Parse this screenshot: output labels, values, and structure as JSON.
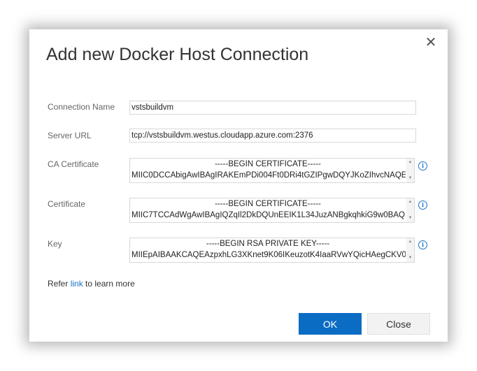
{
  "dialog": {
    "title": "Add new Docker Host Connection",
    "close_glyph": "✕"
  },
  "fields": {
    "connection_name": {
      "label": "Connection Name",
      "value": "vstsbuildvm"
    },
    "server_url": {
      "label": "Server URL",
      "value": "tcp://vstsbuildvm.westus.cloudapp.azure.com:2376"
    },
    "ca_certificate": {
      "label": "CA Certificate",
      "line1": "-----BEGIN CERTIFICATE-----",
      "line2": "MIIC0DCCAbigAwIBAgIRAKEmPDi004Ft0DRi4tGZIPgwDQYJKoZIhvcNAQE"
    },
    "certificate": {
      "label": "Certificate",
      "line1": "-----BEGIN CERTIFICATE-----",
      "line2": "MIIC7TCCAdWgAwIBAgIQZqIl2DkDQUnEEIK1L34JuzANBgkqhkiG9w0BAQ"
    },
    "key": {
      "label": "Key",
      "line1": "-----BEGIN RSA PRIVATE KEY-----",
      "line2": "MIIEpAIBAAKCAQEAzpxhLG3XKnet9K06IKeuzotK4IaaRVwYQicHAegCKV0"
    }
  },
  "refer": {
    "prefix": "Refer ",
    "link": "link",
    "suffix": " to learn more"
  },
  "buttons": {
    "ok": "OK",
    "close": "Close"
  },
  "icons": {
    "info": "i",
    "scroll_up": "▲",
    "scroll_down": "▼"
  },
  "colors": {
    "accent": "#0b6cc4",
    "link": "#1a73c8"
  }
}
